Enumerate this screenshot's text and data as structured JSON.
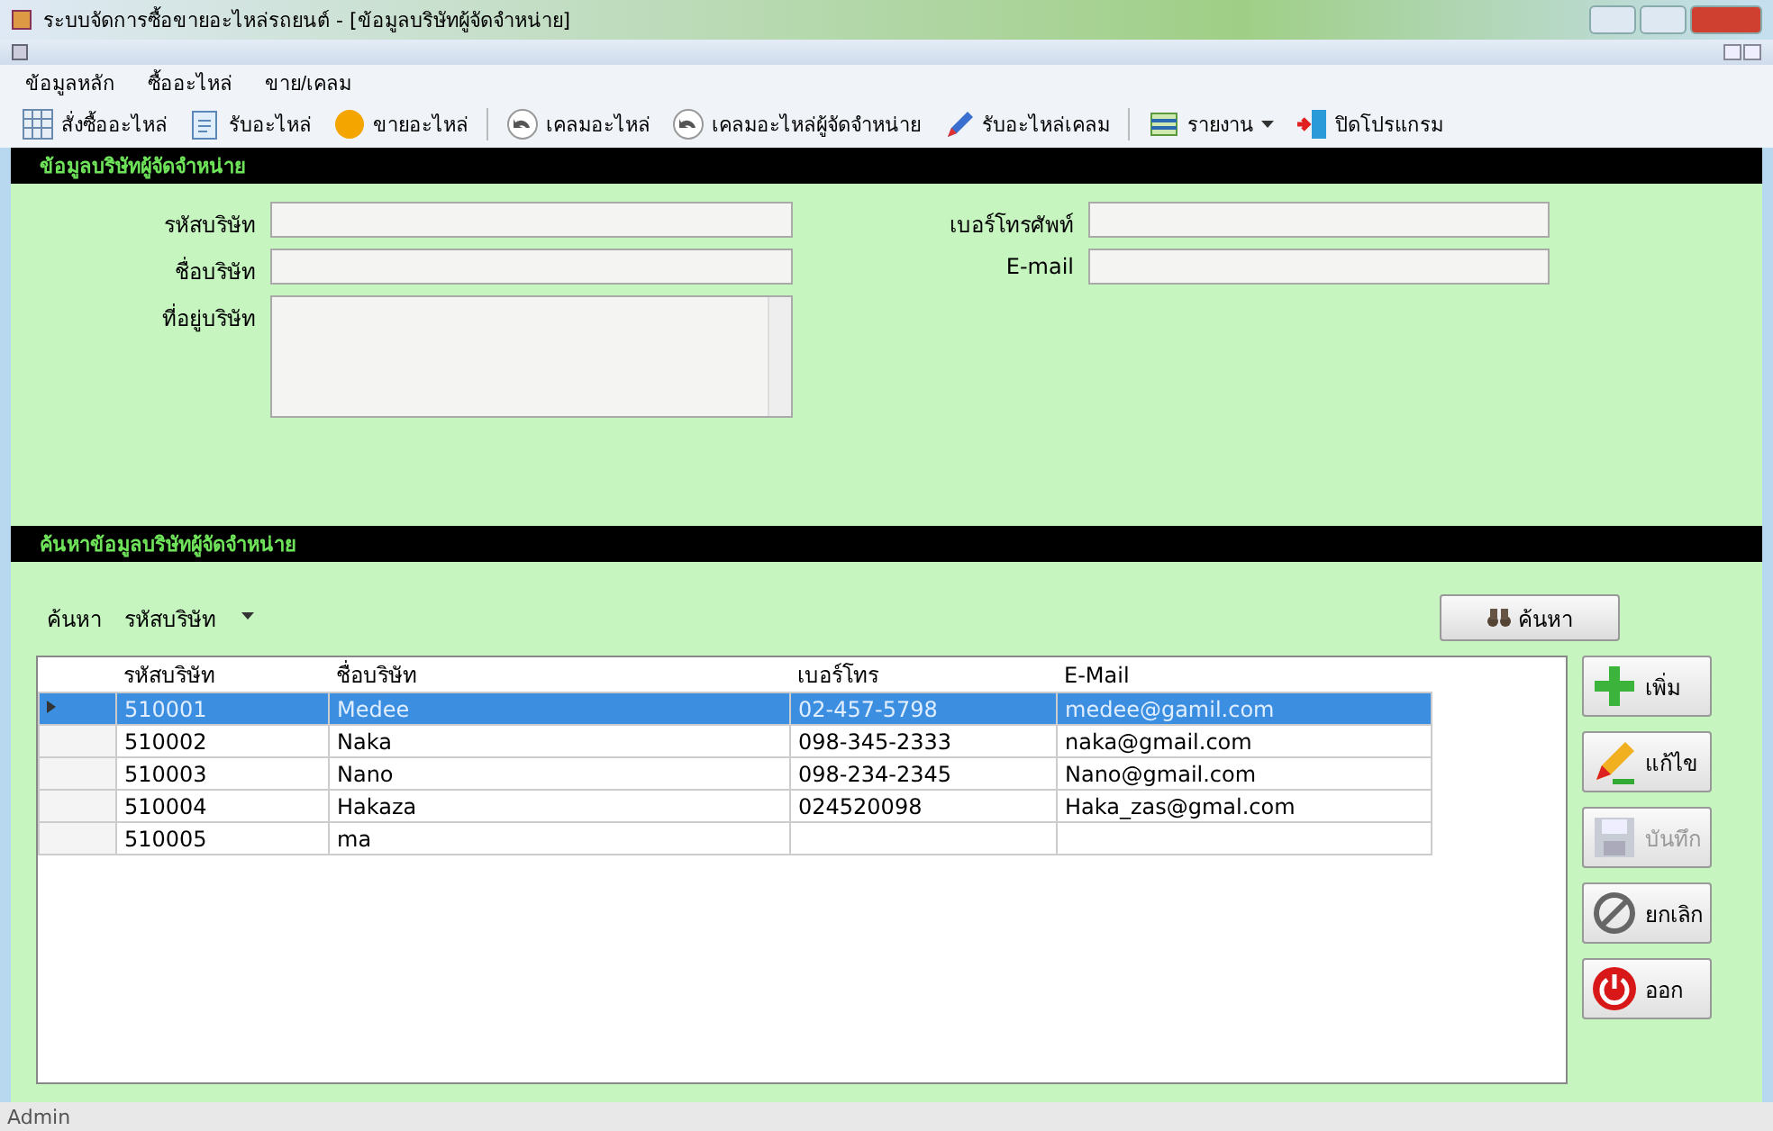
{
  "window": {
    "title": "ระบบจัดการซื้อขายอะไหล่รถยนต์ - [ข้อมูลบริษัทผู้จัดจำหน่าย]"
  },
  "menu": [
    "ข้อมูลหลัก",
    "ซื้ออะไหล่",
    "ขาย/เคลม"
  ],
  "toolbar": [
    {
      "label": "สั่งซื้ออะไหล่",
      "kind": "grid"
    },
    {
      "label": "รับอะไหล่",
      "kind": "doc"
    },
    {
      "label": "ขายอะไหล่",
      "kind": "coin"
    },
    {
      "label": "เคลมอะไหล่",
      "kind": "back"
    },
    {
      "label": "เคลมอะไหล่ผู้จัดจำหน่าย",
      "kind": "back"
    },
    {
      "label": "รับอะไหล่เคลม",
      "kind": "pen"
    },
    {
      "label": "รายงาน",
      "kind": "report",
      "dropdown": true
    },
    {
      "label": "ปิดโปรแกรม",
      "kind": "exit"
    }
  ],
  "company_section": {
    "title": "ข้อมูลบริษัทผู้จัดจำหน่าย",
    "fields": [
      {
        "label": "รหัสบริษัท",
        "kind": "text"
      },
      {
        "label": "ชื่อบริษัท",
        "kind": "text"
      },
      {
        "label": "ที่อยู่บริษัท",
        "kind": "area"
      }
    ],
    "fields_right": [
      {
        "label": "เบอร์โทรศัพท์",
        "kind": "text"
      },
      {
        "label": "E-mail",
        "kind": "text"
      }
    ]
  },
  "search_section": {
    "title": "ค้นหาข้อมูลบริษัทผู้จัดจำหน่าย",
    "label": "ค้นหา",
    "criteria": "รหัสบริษัท",
    "button": "ค้นหา"
  },
  "table": {
    "columns": [
      "รหัสบริษัท",
      "ชื่อบริษัท",
      "เบอร์โทร",
      "E-Mail"
    ],
    "rows": [
      {
        "cells": [
          "510001",
          "Medee",
          "02-457-5798",
          "medee@gamil.com"
        ],
        "selected": true
      },
      {
        "cells": [
          "510002",
          "Naka",
          "098-345-2333",
          "naka@gmail.com"
        ],
        "selected": false
      },
      {
        "cells": [
          "510003",
          "Nano",
          "098-234-2345",
          "Nano@gmail.com"
        ],
        "selected": false
      },
      {
        "cells": [
          "510004",
          "Hakaza",
          "024520098",
          "Haka_zas@gmal.com"
        ],
        "selected": false
      },
      {
        "cells": [
          "510005",
          "ma",
          "",
          ""
        ],
        "selected": false
      }
    ]
  },
  "actions": [
    {
      "label": "เพิ่ม",
      "kind": "add",
      "disabled": false
    },
    {
      "label": "แก้ไข",
      "kind": "edit",
      "disabled": false
    },
    {
      "label": "บันทึก",
      "kind": "save",
      "disabled": true
    },
    {
      "label": "ยกเลิก",
      "kind": "cancel",
      "disabled": false
    },
    {
      "label": "ออก",
      "kind": "exit",
      "disabled": false
    }
  ],
  "status_bar": "Admin"
}
